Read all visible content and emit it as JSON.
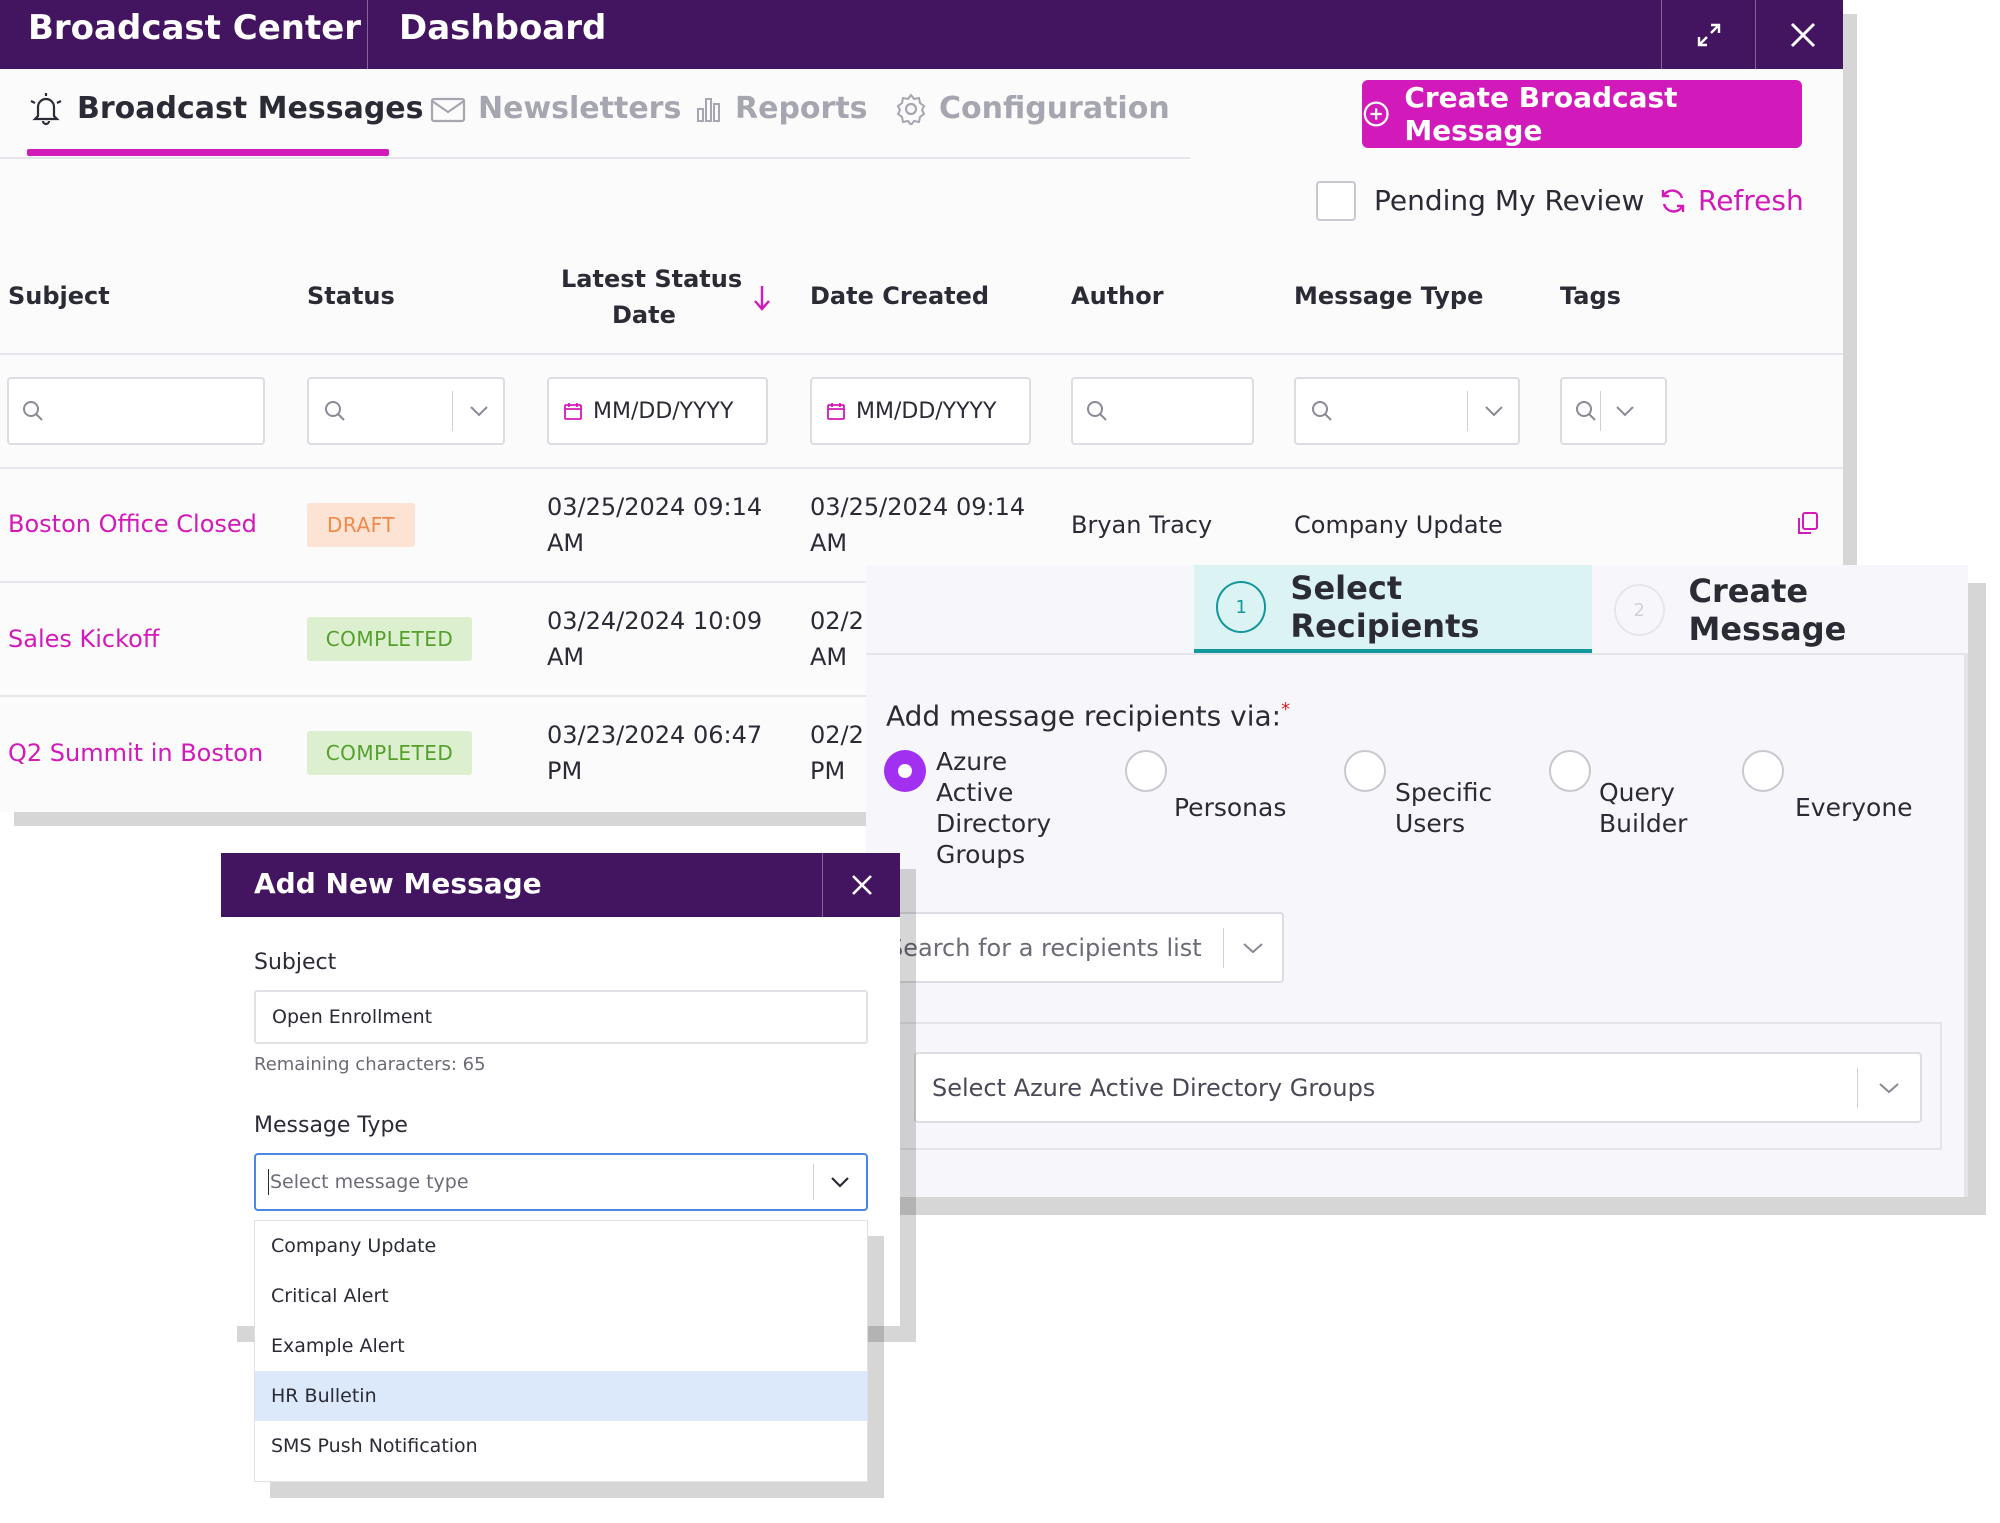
{
  "titlebar": {
    "app_title": "Broadcast Center",
    "section_title": "Dashboard"
  },
  "tabs": [
    {
      "label": "Broadcast Messages",
      "icon": "bell-icon",
      "active": true
    },
    {
      "label": "Newsletters",
      "icon": "envelope-icon",
      "active": false
    },
    {
      "label": "Reports",
      "icon": "bar-chart-icon",
      "active": false
    },
    {
      "label": "Configuration",
      "icon": "gear-icon",
      "active": false
    }
  ],
  "create_button": {
    "label": "Create Broadcast Message",
    "icon": "plus-circle-icon"
  },
  "filters_bar": {
    "pending_label": "Pending My Review",
    "refresh_label": "Refresh"
  },
  "table": {
    "headers": {
      "subject": "Subject",
      "status": "Status",
      "latest_status_date_line1": "Latest Status",
      "latest_status_date_line2": "Date",
      "date_created": "Date Created",
      "author": "Author",
      "message_type": "Message Type",
      "tags": "Tags"
    },
    "date_placeholder": "MM/DD/YYYY",
    "rows": [
      {
        "subject": "Boston Office Closed",
        "status": "DRAFT",
        "latest_date": "03/25/2024 09:14",
        "latest_time": "AM",
        "created_date": "03/25/2024 09:14",
        "created_time": "AM",
        "author": "Bryan Tracy",
        "message_type": "Company Update"
      },
      {
        "subject": "Sales Kickoff",
        "status": "COMPLETED",
        "latest_date": "03/24/2024 10:09",
        "latest_time": "AM",
        "created_date": "02/2",
        "created_time": "AM"
      },
      {
        "subject": "Q2 Summit in Boston",
        "status": "COMPLETED",
        "latest_date": "03/23/2024 06:47",
        "latest_time": "PM",
        "created_date": "02/2",
        "created_time": "PM"
      }
    ]
  },
  "recipients_panel": {
    "steps": [
      {
        "number": "1",
        "label": "Select Recipients",
        "active": true
      },
      {
        "number": "2",
        "label": "Create Message",
        "active": false
      }
    ],
    "question": "Add message recipients via:",
    "required_mark": "*",
    "options": [
      {
        "line1": "Azure",
        "line2": "Active",
        "line3": "Directory",
        "line4": "Groups",
        "selected": true
      },
      {
        "line1": "Personas",
        "selected": false
      },
      {
        "line1": "Specific",
        "line2": "Users",
        "selected": false
      },
      {
        "line1": "Query",
        "line2": "Builder",
        "selected": false
      },
      {
        "line1": "Everyone",
        "selected": false
      }
    ],
    "search_placeholder": "Search for a recipients list",
    "groups_placeholder": "Select Azure Active Directory Groups",
    "accent_color": "#12979a",
    "radio_color": "#a230f0"
  },
  "add_message_dialog": {
    "title": "Add New Message",
    "subject_label": "Subject",
    "subject_value": "Open Enrollment",
    "remaining_text": "Remaining characters: 65",
    "message_type_label": "Message Type",
    "message_type_placeholder": "Select message type",
    "options": [
      "Company Update",
      "Critical Alert",
      "Example Alert",
      "HR Bulletin",
      "SMS Push Notification"
    ],
    "highlighted_option": "HR Bulletin"
  },
  "colors": {
    "brand_purple": "#43145f",
    "accent_magenta": "#d219b9",
    "draft_orange": "#f08a4b",
    "completed_green": "#55a02c"
  }
}
